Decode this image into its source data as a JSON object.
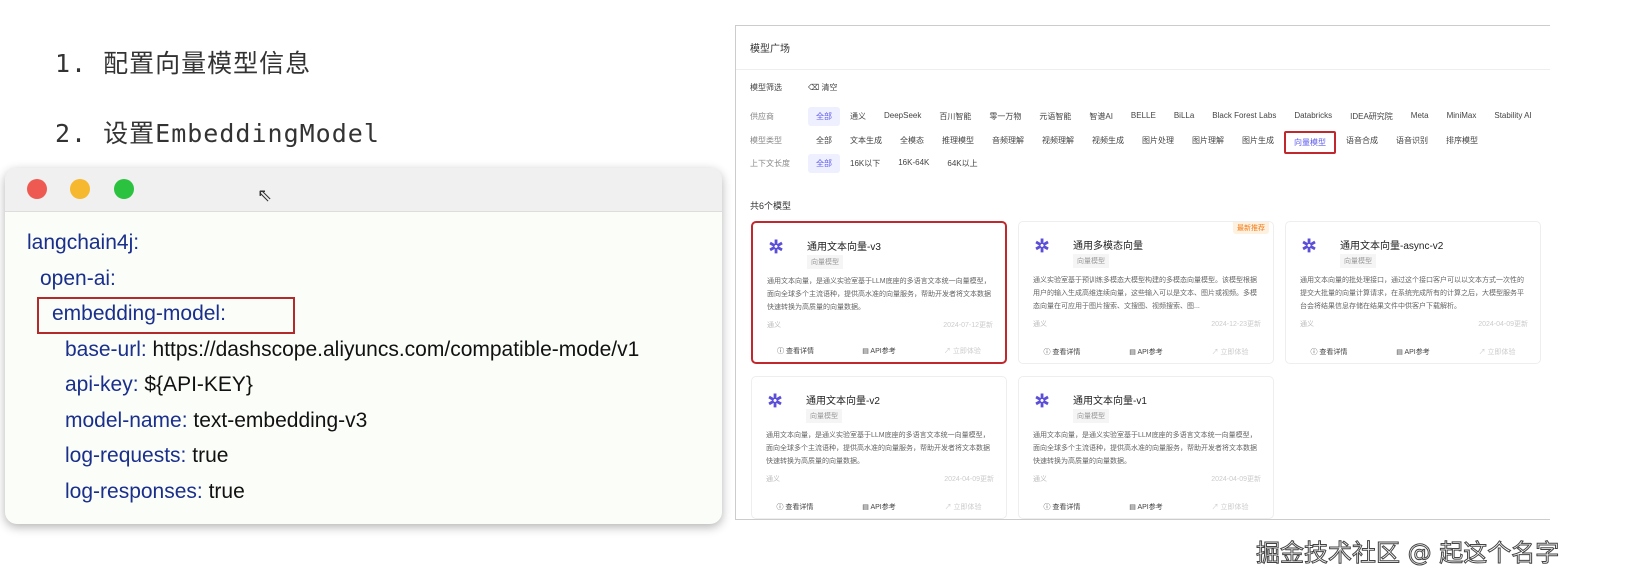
{
  "steps": [
    "1. 配置向量模型信息",
    "2. 设置EmbeddingModel"
  ],
  "window": {
    "dot_colors": [
      "#ee5a52",
      "#f5b82e",
      "#2bc23f"
    ],
    "code": [
      {
        "key": "langchain4j:",
        "value": ""
      },
      {
        "key": "open-ai:",
        "value": ""
      },
      {
        "key": "embedding-model:",
        "value": ""
      },
      {
        "key": "base-url:",
        "value": " https://dashscope.aliyuncs.com/compatible-mode/v1"
      },
      {
        "key": "api-key:",
        "value": " ${API-KEY}"
      },
      {
        "key": "model-name:",
        "value": " text-embedding-v3"
      },
      {
        "key": "log-requests:",
        "value": " true"
      },
      {
        "key": "log-responses:",
        "value": " true"
      }
    ]
  },
  "panel": {
    "title": "模型广场",
    "filter_label": "模型筛选",
    "clear": "清空",
    "rows": [
      {
        "label": "供应商",
        "items": [
          "全部",
          "通义",
          "DeepSeek",
          "百川智能",
          "零一万物",
          "元语智能",
          "智谱AI",
          "BELLE",
          "BiLLa",
          "Black Forest Labs",
          "Databricks",
          "IDEA研究院",
          "Meta",
          "MiniMax",
          "Stability AI"
        ],
        "selected": 0
      },
      {
        "label": "模型类型",
        "items": [
          "全部",
          "文本生成",
          "全模态",
          "推理模型",
          "音频理解",
          "视频理解",
          "视频生成",
          "图片处理",
          "图片理解",
          "图片生成",
          "向量模型",
          "语音合成",
          "语音识别",
          "排序模型"
        ],
        "selected": 10
      },
      {
        "label": "上下文长度",
        "items": [
          "全部",
          "16K以下",
          "16K-64K",
          "64K以上"
        ],
        "selected": 0
      }
    ],
    "count": "共6个模型",
    "cards": [
      {
        "name": "通用文本向量-v3",
        "tag": "向量模型",
        "desc": "通用文本向量，是通义实验室基于LLM底座的多语言文本统一向量模型，面向全球多个主流语种，提供高水准的向量服务，帮助开发者将文本数据快速转换为高质量的向量数据。",
        "provider": "通义",
        "date": "2024-07-12更新",
        "badge": "",
        "highlighted": true
      },
      {
        "name": "通用多模态向量",
        "tag": "向量模型",
        "desc": "通义实验室基于预训练多模态大模型构建的多模态向量模型。该模型根据用户的输入生成高维连续向量，这些输入可以是文本、图片或视频。多模态向量在可应用于图片搜索、文搜图、视频搜索、图...",
        "provider": "通义",
        "date": "2024-12-23更新",
        "badge": "最新推荐",
        "highlighted": false
      },
      {
        "name": "通用文本向量-async-v2",
        "tag": "向量模型",
        "desc": "通用文本向量的批处理接口，通过这个接口客户可以以文本方式一次性的提交大批量的向量计算请求，在系统完成所有的计算之后，大模型服务平台会将结果信息存储在结果文件中供客户下载解析。",
        "provider": "通义",
        "date": "2024-04-09更新",
        "badge": "",
        "highlighted": false
      },
      {
        "name": "通用文本向量-v2",
        "tag": "向量模型",
        "desc": "通用文本向量，是通义实验室基于LLM底座的多语言文本统一向量模型，面向全球多个主流语种，提供高水准的向量服务，帮助开发者将文本数据快速转换为高质量的向量数据。",
        "provider": "通义",
        "date": "2024-04-09更新",
        "badge": "",
        "highlighted": false
      },
      {
        "name": "通用文本向量-v1",
        "tag": "向量模型",
        "desc": "通用文本向量，是通义实验室基于LLM底座的多语言文本统一向量模型，面向全球多个主流语种，提供高水准的向量服务，帮助开发者将文本数据快速转换为高质量的向量数据。",
        "provider": "通义",
        "date": "2024-04-09更新",
        "badge": "",
        "highlighted": false
      }
    ],
    "actions": [
      "ⓘ 查看详情",
      "▤ API参考",
      "↗ 立即体验"
    ]
  },
  "watermark": "掘金技术社区 @ 起这个名字"
}
